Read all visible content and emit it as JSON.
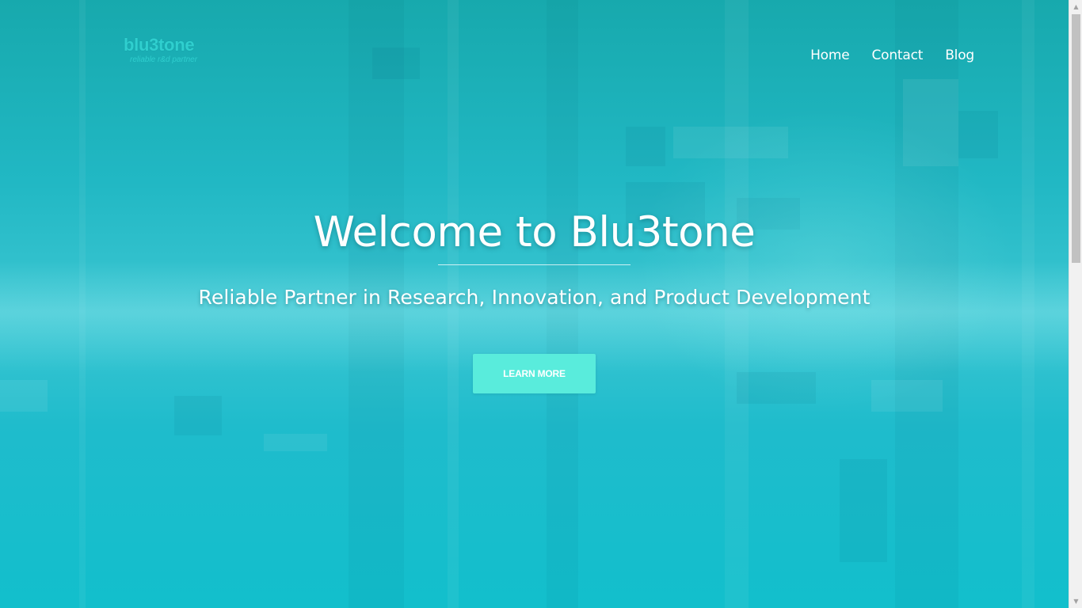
{
  "brand": {
    "name": "blu3tone",
    "tagline": "reliable r&d partner"
  },
  "nav": {
    "items": [
      {
        "label": "Home"
      },
      {
        "label": "Contact"
      },
      {
        "label": "Blog"
      }
    ]
  },
  "hero": {
    "title": "Welcome to Blu3tone",
    "subtitle": "Reliable Partner in Research, Innovation, and Product Development",
    "cta_label": "LEARN MORE"
  },
  "scrollbar": {
    "up_icon": "▲",
    "down_icon": "▼"
  },
  "colors": {
    "accent": "#59ecdc",
    "logo": "#2fcfcf",
    "hero_top": "#17a9ad",
    "hero_bottom": "#12bfcc"
  }
}
